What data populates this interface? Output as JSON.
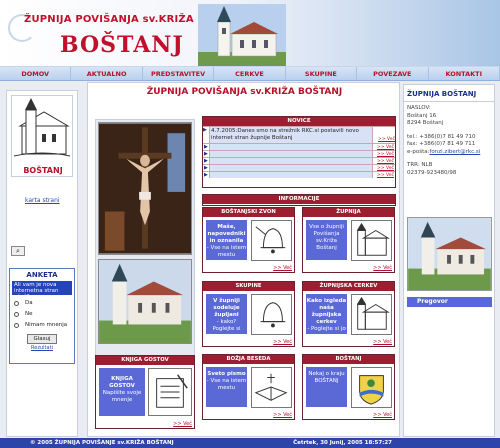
{
  "header": {
    "line1": "ŽUPNIJA POVIŠANJA sv.KRIŽA",
    "line2": "BOŠTANJ"
  },
  "nav": [
    "DOMOV",
    "AKTUALNO",
    "PREDSTAVITEV",
    "CERKVE",
    "SKUPINE",
    "POVEZAVE",
    "KONTAKTI"
  ],
  "left": {
    "logo_text": "BOŠTANJ",
    "karta": "karta strani",
    "search_icon": "search-icon",
    "anketa": {
      "title": "ANKETA",
      "question": "Ali vam je nova internetna stran všeč?",
      "options": [
        "Da",
        "Ne",
        "Nimam mnenja"
      ],
      "vote": "Glasuj",
      "results": "Rezultati"
    }
  },
  "main": {
    "title": "ŽUPNIJA POVIŠANJA sv.KRIŽA BOŠTANJ",
    "novice": {
      "title": "NOVICE",
      "first": "4.7.2005:Danes smo na strežnik RKC.si postavili novo internet stran župnije Boštanj",
      "more": ">> Več"
    },
    "informacije": "INFORMACIJE",
    "cards": [
      {
        "title": "BOŠTANJSKI ZVON",
        "bold": "Maše, napovedniki in oznanila",
        "text": "- Vse na istem mestu",
        "more": ">> Več"
      },
      {
        "title": "ŽUPNIJA",
        "bold": "",
        "text": "Vse o župniji Povišanja sv.Križa Boštanj",
        "more": ">> Več"
      },
      {
        "title": "SKUPINE",
        "bold": "V župniji sodeluje župljani",
        "text": "- kako? Poglejte si",
        "more": ">> Več"
      },
      {
        "title": "ŽUPNIJSKA CERKEV",
        "bold": "Kako izgleda naša župnijska cerkev",
        "text": "- Poglejte si jo",
        "more": ">> Več"
      },
      {
        "title": "BOŽJA BESEDA",
        "bold": "Sveto pismo",
        "text": "- Vse na istem mestu",
        "more": ">> Več"
      },
      {
        "title": "BOŠTANJ",
        "bold": "",
        "text": "Nekaj o kraju BOŠTANJ",
        "more": ">> Več"
      }
    ],
    "knjiga": {
      "title": "KNJIGA GOSTOV",
      "bold": "KNJIGA GOSTOV",
      "text": "Napišite svoje mnenje",
      "more": ">> Več"
    }
  },
  "right": {
    "title": "ŽUPNIJA BOŠTANJ",
    "naslov_label": "NASLOV:",
    "addr1": "Boštanj 16",
    "addr2": "8294 Boštanj",
    "tel": "tel.: +386(0)7 81 49 710",
    "fax": "fax: +386(0)7 81 49 711",
    "email_label": "e-pošta:",
    "email": "fonzi.zibert@rkc.si",
    "trr": "TRR: NLB",
    "trr_num": "02379-923480/98",
    "pregovor": "Pregovor"
  },
  "footer": {
    "left": "©  2005  ŽUPNIJA POVIŠANJE sv.KRIŽA BOŠTANJ",
    "right": "Četrtek, 30 Junij, 2005 18:57:27"
  }
}
